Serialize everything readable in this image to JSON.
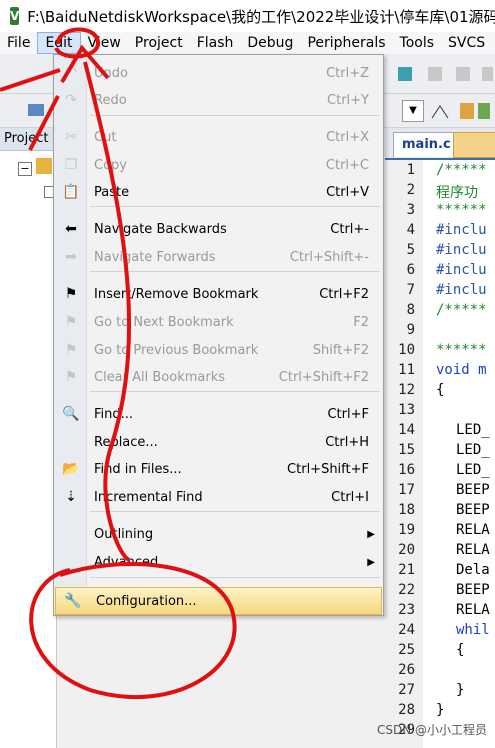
{
  "window": {
    "title": "F:\\BaiduNetdiskWorkspace\\我的工作\\2022毕业设计\\停车库\\01源码"
  },
  "menubar": {
    "items": [
      "File",
      "Edit",
      "View",
      "Project",
      "Flash",
      "Debug",
      "Peripherals",
      "Tools",
      "SVCS"
    ],
    "active": "Edit"
  },
  "project_panel": {
    "tab_label": "Project"
  },
  "editor": {
    "active_tab": "main.c",
    "line_numbers": [
      "1",
      "2",
      "3",
      "4",
      "5",
      "6",
      "7",
      "8",
      "9",
      "10",
      "11",
      "12",
      "13",
      "14",
      "15",
      "16",
      "17",
      "18",
      "19",
      "20",
      "21",
      "22",
      "23",
      "24",
      "25",
      "26",
      "27",
      "28",
      "29"
    ],
    "lines": [
      "/*****",
      "程序功",
      "******",
      "#inclu",
      "#inclu",
      "#inclu",
      "#inclu",
      "/*****",
      "",
      "******",
      "void m",
      "{",
      "",
      "LED_",
      "LED_",
      "LED_",
      "BEEP",
      "BEEP",
      "RELA",
      "RELA",
      "Dela",
      "BEEP",
      "RELA",
      "whil",
      "{",
      "",
      "}",
      "}",
      ""
    ]
  },
  "edit_menu": {
    "items": [
      {
        "icon": "undo-icon",
        "label": "Undo",
        "shortcut": "Ctrl+Z",
        "enabled": false
      },
      {
        "icon": "redo-icon",
        "label": "Redo",
        "shortcut": "Ctrl+Y",
        "enabled": false
      },
      {
        "icon": "cut-icon",
        "label": "Cut",
        "shortcut": "Ctrl+X",
        "enabled": false
      },
      {
        "icon": "copy-icon",
        "label": "Copy",
        "shortcut": "Ctrl+C",
        "enabled": false
      },
      {
        "icon": "paste-icon",
        "label": "Paste",
        "shortcut": "Ctrl+V",
        "enabled": true
      },
      {
        "icon": "navigate-back-icon",
        "label": "Navigate Backwards",
        "shortcut": "Ctrl+-",
        "enabled": true
      },
      {
        "icon": "navigate-forward-icon",
        "label": "Navigate Forwards",
        "shortcut": "Ctrl+Shift+-",
        "enabled": false
      },
      {
        "icon": "bookmark-icon",
        "label": "Insert/Remove Bookmark",
        "shortcut": "Ctrl+F2",
        "enabled": true
      },
      {
        "icon": "next-bookmark-icon",
        "label": "Go to Next Bookmark",
        "shortcut": "F2",
        "enabled": false
      },
      {
        "icon": "prev-bookmark-icon",
        "label": "Go to Previous Bookmark",
        "shortcut": "Shift+F2",
        "enabled": false
      },
      {
        "icon": "clear-bookmarks-icon",
        "label": "Clear All Bookmarks",
        "shortcut": "Ctrl+Shift+F2",
        "enabled": false
      },
      {
        "icon": "find-icon",
        "label": "Find...",
        "shortcut": "Ctrl+F",
        "enabled": true
      },
      {
        "icon": "",
        "label": "Replace...",
        "shortcut": "Ctrl+H",
        "enabled": true
      },
      {
        "icon": "find-in-files-icon",
        "label": "Find in Files...",
        "shortcut": "Ctrl+Shift+F",
        "enabled": true
      },
      {
        "icon": "incremental-find-icon",
        "label": "Incremental Find",
        "shortcut": "Ctrl+I",
        "enabled": true
      },
      {
        "icon": "",
        "label": "Outlining",
        "shortcut": "",
        "enabled": true
      },
      {
        "icon": "",
        "label": "Advanced",
        "shortcut": "",
        "enabled": true
      },
      {
        "icon": "wrench-icon",
        "label": "Configuration...",
        "shortcut": "",
        "enabled": true
      }
    ]
  },
  "watermark": "CSDN @小小工程员",
  "colors": {
    "annotation": "#e01010",
    "highlight": "#f6d87a",
    "accent": "#1a3e8c"
  }
}
